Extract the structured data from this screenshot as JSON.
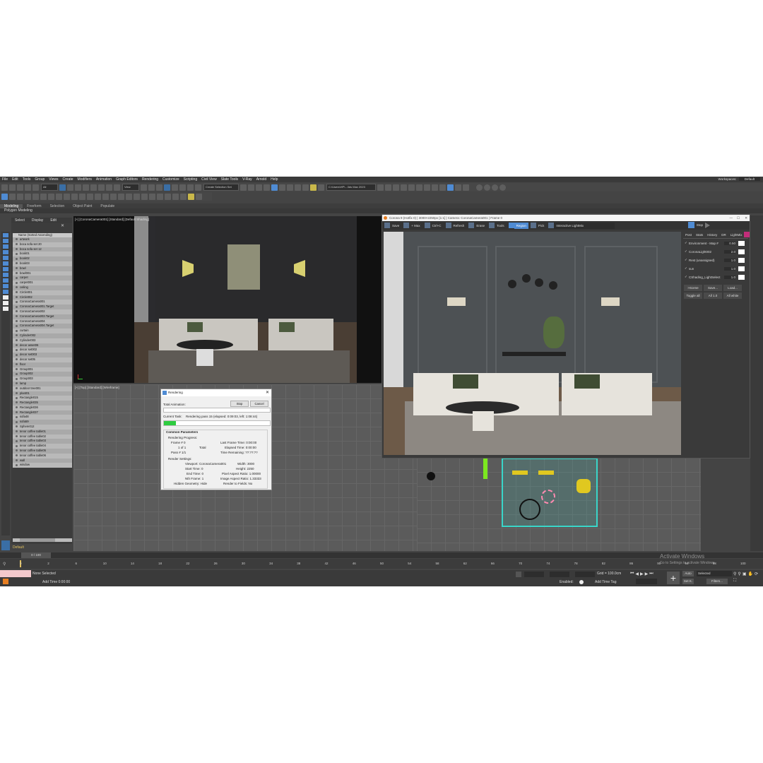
{
  "menu": [
    "File",
    "Edit",
    "Tools",
    "Group",
    "Views",
    "Create",
    "Modifiers",
    "Animation",
    "Graph Editors",
    "Rendering",
    "Customize",
    "Scripting",
    "Civil View",
    "Slate Tools",
    "V-Ray",
    "Arnold",
    "Help"
  ],
  "workspaces": {
    "label": "Workspaces:",
    "value": "Default"
  },
  "toolbar": {
    "filter": "All",
    "view": "View",
    "selection_set": "Create Selection Set",
    "path": "C:\\Users\\HP\\...3ds Max 2023"
  },
  "ribbon": {
    "tabs": [
      "Modeling",
      "Freeform",
      "Selection",
      "Object Paint",
      "Populate"
    ],
    "sub": "Polygon Modeling"
  },
  "scene_explorer": {
    "tabs": [
      "Select",
      "Display",
      "Edit"
    ],
    "header": "Name (Sorted Ascending)",
    "items": [
      "artwork",
      "boca sofa set 20",
      "boca sofa set 12",
      "book01",
      "book02",
      "book03",
      "bowl",
      "bowl001",
      "carpet",
      "carpet001",
      "ceiling",
      "Circle001",
      "Circle002",
      "CoronaCamera001",
      "CoronaCamera001.Target",
      "CoronaCamera002",
      "CoronaCamera003.Target",
      "CoronaCamera004",
      "CoronaCamera004.Target",
      "curtain",
      "Cylinder002",
      "Cylinder003",
      "decor asset06",
      "decor set002",
      "decor set003",
      "decor set05",
      "floor",
      "Group001",
      "Group002",
      "Group003",
      "lamp",
      "outdoor tree001",
      "plant01",
      "Rectangle015",
      "Rectangle035",
      "Rectangle036",
      "Rectangle037",
      "sofa48",
      "sofa59",
      "Sphere012",
      "tenor coffee table01",
      "tenor coffee table02",
      "tenor coffee table03",
      "tenor coffee table04",
      "tenor coffee table05",
      "tenor coffee table06",
      "wall",
      "window"
    ],
    "layer": "Default"
  },
  "viewports": {
    "camera": "[+] [CoronaCamera001] [Standard] [Default Shading]",
    "top": "[+] [Top] [Standard] [Wireframe]"
  },
  "render_dialog": {
    "title": "Rendering",
    "total_animation": "Total Animation:",
    "stop": "Stop",
    "cancel": "Cancel",
    "current_task_label": "Current Task:",
    "current_task": "Rendering pass 15 (elapsed: 0:09:03, left: 1:08:44)",
    "progress": 0.11,
    "section": "Common Parameters",
    "rendering_progress": "Rendering Progress:",
    "frame_label": "Frame #",
    "frame_value": "0",
    "of": "1 of 1",
    "total": "Total",
    "pass_label": "Pass #",
    "pass_value": "1/1",
    "last_frame_label": "Last Frame Time:",
    "last_frame": "0:00:00",
    "elapsed_label": "Elapsed Time:",
    "elapsed": "0:00:00",
    "remaining_label": "Time Remaining:",
    "remaining": "??:??:??",
    "render_settings": "Render Settings:",
    "viewport_label": "Viewport:",
    "viewport": "CoronaCamera001",
    "width_label": "Width:",
    "width": "3000",
    "start_label": "Start Time:",
    "start": "0",
    "height_label": "Height:",
    "height": "2250",
    "end_label": "End Time:",
    "end": "0",
    "pixel_aspect_label": "Pixel Aspect Ratio:",
    "pixel_aspect": "1.00000",
    "nth_label": "Nth Frame:",
    "nth": "1",
    "image_aspect_label": "Image Aspect Ratio:",
    "image_aspect": "1.33333",
    "hidden_label": "Hidden Geometry:",
    "hidden": "Hide",
    "fields_label": "Render to Fields:",
    "fields": "No"
  },
  "vfb": {
    "title": "Corona 9 (Hotfix 0) | 3000×2250px [1:1] | Camera: CoronaCamera001 | Frame 0",
    "buttons": [
      "Save",
      "+ Max",
      "Ctrl+C",
      "Refresh",
      "Erase",
      "Tools",
      "Region",
      "Pick",
      "Interactive LightMix"
    ],
    "stop": "Stop",
    "tabs": [
      "Post",
      "Stats",
      "History",
      "DR",
      "LightMix"
    ],
    "lightmix": [
      {
        "label": "Environment - Map #",
        "value": "0.50"
      },
      {
        "label": "CoronaLight002",
        "value": "2.0"
      },
      {
        "label": "Rest (unassigned)",
        "value": "1.0"
      },
      {
        "label": "sun",
        "value": "1.0"
      },
      {
        "label": "CShading_LightSelect",
        "value": "1.0"
      }
    ],
    "lm_buttons": [
      ">Scene",
      "Save...",
      "Load...",
      "Toggle all",
      "All 1.0",
      "All white"
    ]
  },
  "timeline": {
    "frame": "0 / 100",
    "ticks": [
      "0",
      "2",
      "6",
      "10",
      "14",
      "18",
      "22",
      "26",
      "30",
      "34",
      "38",
      "42",
      "46",
      "50",
      "54",
      "58",
      "62",
      "66",
      "70",
      "74",
      "78",
      "82",
      "86",
      "90",
      "94",
      "98",
      "100"
    ]
  },
  "status": {
    "selection": "None Selected",
    "time": "Add Time 0:00:00",
    "grid": "Grid = 100.0cm",
    "enabled": "Enabled:",
    "add_time_tag": "Add Time Tag",
    "auto": "Auto",
    "selected": "Selected",
    "set_k": "Set K.",
    "filters": "Filters..."
  },
  "watermark": {
    "title": "Activate Windows",
    "sub": "Go to Settings to activate Windows."
  },
  "colors": {
    "accent": "#4f8bd3",
    "bg": "#444444",
    "wire": "#39d6c9",
    "progress": "#2ecc40"
  }
}
